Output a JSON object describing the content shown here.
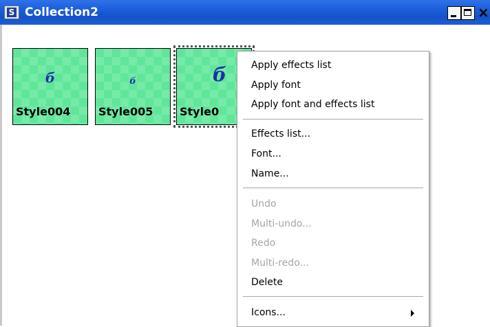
{
  "window": {
    "title": "Collection2",
    "app_icon_letter": "S",
    "buttons": {
      "minimize": "minimize-button",
      "maximize": "maximize-button",
      "close_label": "×"
    }
  },
  "styles": [
    {
      "glyph": "б",
      "label": "Style004"
    },
    {
      "glyph": "б",
      "label": "Style005"
    },
    {
      "glyph": "б",
      "label": "Style0"
    }
  ],
  "context_menu": {
    "apply_effects": "Apply effects list",
    "apply_font": "Apply font",
    "apply_font_effects": "Apply font and effects list",
    "effects_list": "Effects list...",
    "font": "Font...",
    "name": "Name...",
    "undo": "Undo",
    "multi_undo": "Multi-undo...",
    "redo": "Redo",
    "multi_redo": "Multi-redo...",
    "delete": "Delete",
    "icons": "Icons..."
  },
  "colors": {
    "titlebar": "#1d5fdc",
    "thumbnail_bg": "#5fe69a",
    "glyph": "#1b2fa8",
    "disabled_text": "#a5a5a5"
  }
}
